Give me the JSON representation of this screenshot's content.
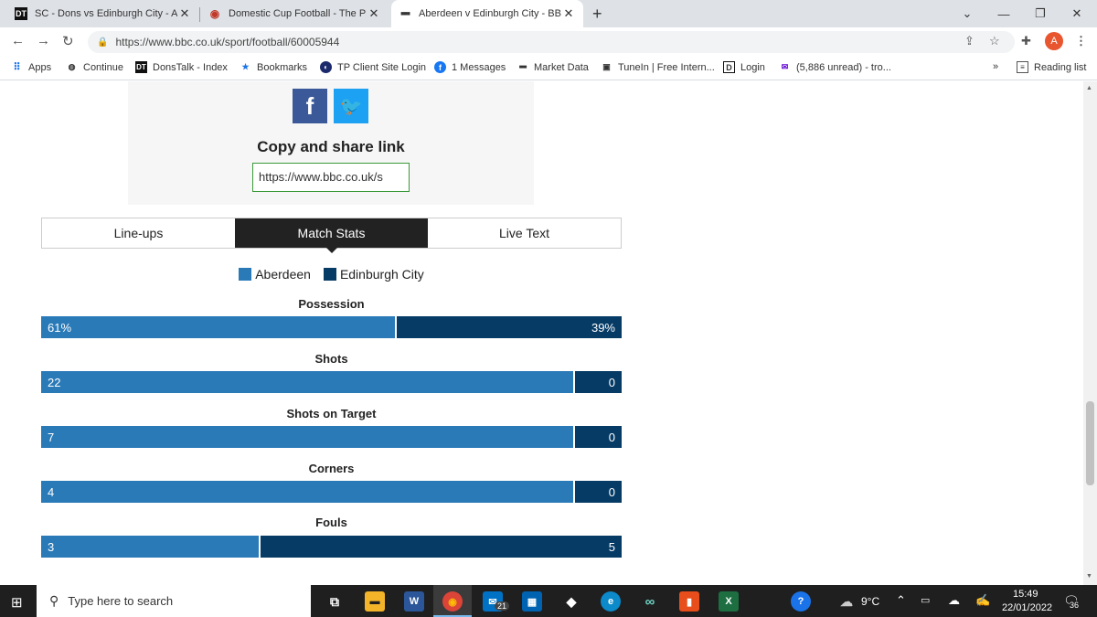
{
  "browser": {
    "tabs": [
      {
        "title": "SC - Dons vs Edinburgh City - Ab",
        "favicon": "DT"
      },
      {
        "title": "Domestic Cup Football - The Pie",
        "favicon": "pie"
      },
      {
        "title": "Aberdeen v Edinburgh City - BBC",
        "favicon": "BBC"
      }
    ],
    "url": "https://www.bbc.co.uk/sport/football/60005944",
    "profile_initial": "A"
  },
  "bookmarks": {
    "items": [
      {
        "label": "Apps"
      },
      {
        "label": "Continue"
      },
      {
        "label": "DonsTalk - Index"
      },
      {
        "label": "Bookmarks"
      },
      {
        "label": "TP Client Site Login"
      },
      {
        "label": "1 Messages"
      },
      {
        "label": "Market Data"
      },
      {
        "label": "TuneIn | Free Intern..."
      },
      {
        "label": "Login"
      },
      {
        "label": "(5,886 unread) - tro..."
      }
    ],
    "overflow": "»",
    "reading_list": "Reading list"
  },
  "share": {
    "title": "Copy and share link",
    "link_value": "https://www.bbc.co.uk/s"
  },
  "match_tabs": {
    "lineups": "Line-ups",
    "stats": "Match Stats",
    "live": "Live Text"
  },
  "legend": {
    "home": "Aberdeen",
    "away": "Edinburgh City",
    "home_color": "#2a7ab8",
    "away_color": "#063b66"
  },
  "stats": [
    {
      "label": "Possession",
      "home": "61%",
      "away": "39%",
      "home_share": 0.61
    },
    {
      "label": "Shots",
      "home": "22",
      "away": "0",
      "home_share": 0.917
    },
    {
      "label": "Shots on Target",
      "home": "7",
      "away": "0",
      "home_share": 0.917
    },
    {
      "label": "Corners",
      "home": "4",
      "away": "0",
      "home_share": 0.917
    },
    {
      "label": "Fouls",
      "home": "3",
      "away": "5",
      "home_share": 0.375
    }
  ],
  "taskbar": {
    "search_placeholder": "Type here to search",
    "mail_badge": "21",
    "weather": "9°C",
    "time": "15:49",
    "date": "22/01/2022",
    "notifications": "36"
  }
}
